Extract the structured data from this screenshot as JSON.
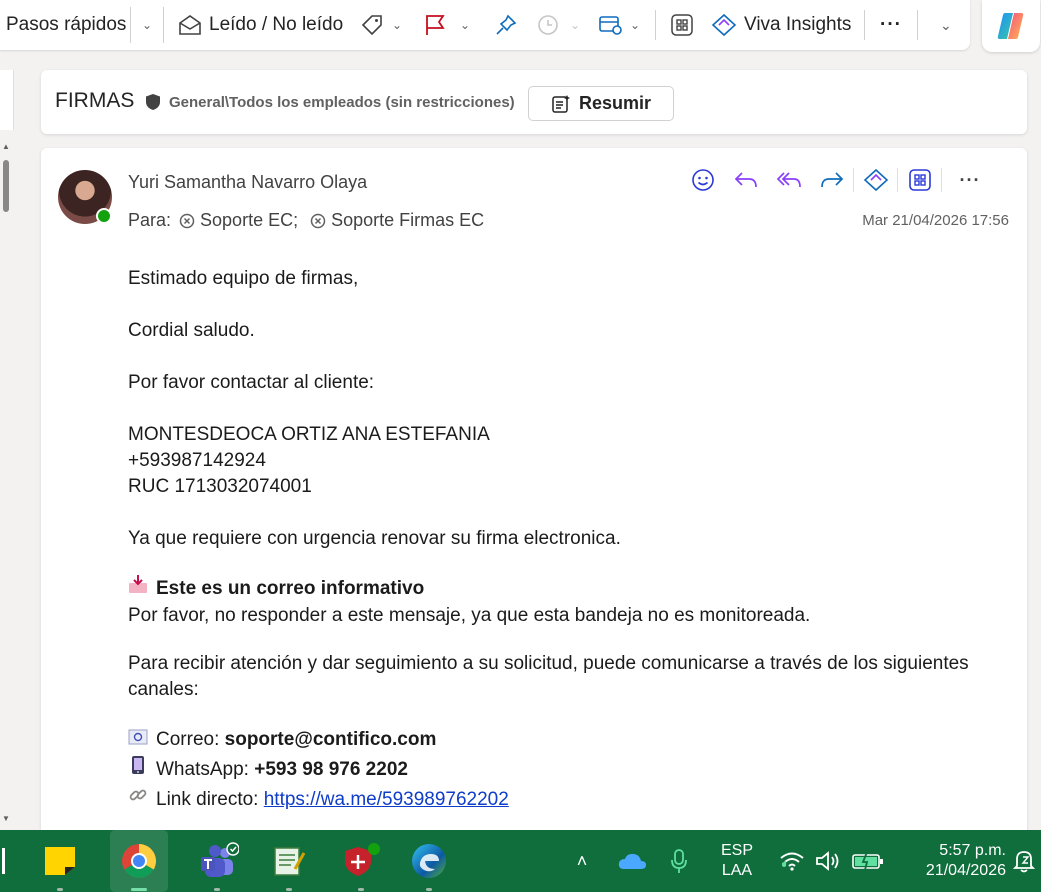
{
  "ribbon": {
    "quick_steps": "Pasos rápidos",
    "read_unread": "Leído / No leído",
    "viva": "Viva Insights",
    "more": "···"
  },
  "subject": {
    "title": "FIRMAS",
    "sensitivity": "General\\Todos los empleados (sin restricciones)",
    "summarize": "Resumir"
  },
  "message": {
    "sender": "Yuri Samantha Navarro Olaya",
    "to_label": "Para:",
    "recipients": [
      "Soporte EC;",
      "Soporte Firmas EC"
    ],
    "date": "Mar 21/04/2026 17:56",
    "body": {
      "greeting": "Estimado equipo de firmas,",
      "salute": "Cordial saludo.",
      "request": "Por favor contactar al cliente:",
      "client_name": "MONTESDEOCA ORTIZ ANA ESTEFANIA",
      "client_phone": "+593987142924",
      "client_ruc": "RUC 1713032074001",
      "reason": "Ya que requiere con urgencia renovar su firma electronica.",
      "info_title": "Este es un correo informativo",
      "info_text": "Por favor, no responder a este mensaje, ya que esta bandeja no es monitoreada.",
      "channels_intro": "Para recibir atención y dar seguimiento a su solicitud, puede comunicarse a través de los siguientes canales:",
      "email_label": "Correo:",
      "email_value": "soporte@contifico.com",
      "whatsapp_label": "WhatsApp:",
      "whatsapp_value": "+593 98 976 2202",
      "link_label": "Link directo:",
      "link_value": "https://wa.me/593989762202"
    }
  },
  "taskbar": {
    "lang_top": "ESP",
    "lang_bottom": "LAA",
    "time": "5:57 p.m.",
    "date": "21/04/2026"
  },
  "colors": {
    "accent": "#0f6cbd",
    "reply_purple": "#8a3ffc",
    "flag_red": "#c50f1f",
    "taskbar_green": "#0f6e3c"
  }
}
